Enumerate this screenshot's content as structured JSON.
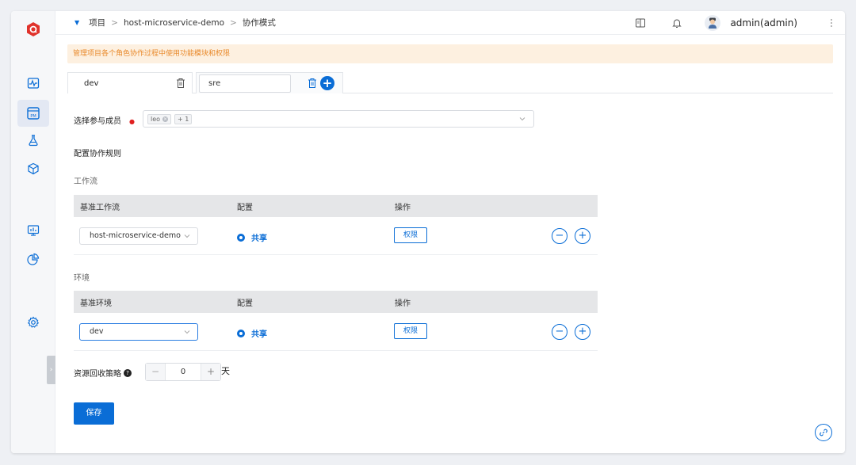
{
  "breadcrumb": {
    "root": "项目",
    "separator": ">",
    "project": "host-microservice-demo",
    "page": "协作模式"
  },
  "header": {
    "user_name": "admin(admin)",
    "icons": [
      "book-icon",
      "bell-icon",
      "avatar",
      "more-vertical-icon"
    ]
  },
  "sidebar": {
    "items": [
      "logo",
      "pulse-icon",
      "pm-icon",
      "flask-icon",
      "package-icon",
      "monitor-chart-icon",
      "pie-chart-icon",
      "gear-icon"
    ],
    "toggle": "›"
  },
  "notice": "管理项目各个角色协作过程中使用功能模块和权限",
  "tabs": {
    "items": [
      {
        "label": "dev",
        "active": true
      },
      {
        "label": "sre",
        "active": false,
        "editing": true
      }
    ],
    "add": "+"
  },
  "members": {
    "label": "选择参与成员",
    "required_mark": "●",
    "chips": [
      "leo",
      "+ 1"
    ]
  },
  "rules": {
    "title": "配置协作规则",
    "workflow": {
      "title": "工作流",
      "columns": [
        "基准工作流",
        "配置",
        "操作"
      ],
      "row": {
        "base": "host-microservice-demo",
        "config": "共享",
        "action": "权限"
      }
    },
    "environment": {
      "title": "环境",
      "columns": [
        "基准环境",
        "配置",
        "操作"
      ],
      "row": {
        "base": "dev",
        "config": "共享",
        "action": "权限"
      }
    },
    "row_buttons": {
      "remove": "−",
      "add": "+"
    }
  },
  "recycle": {
    "label": "资源回收策略",
    "minus": "−",
    "value": "0",
    "plus": "+",
    "unit": "天"
  },
  "save_label": "保存",
  "colors": {
    "primary": "#0a6dd6",
    "notice_bg": "#fdf0e0",
    "notice_text": "#e98a2c",
    "required": "#e02020"
  }
}
